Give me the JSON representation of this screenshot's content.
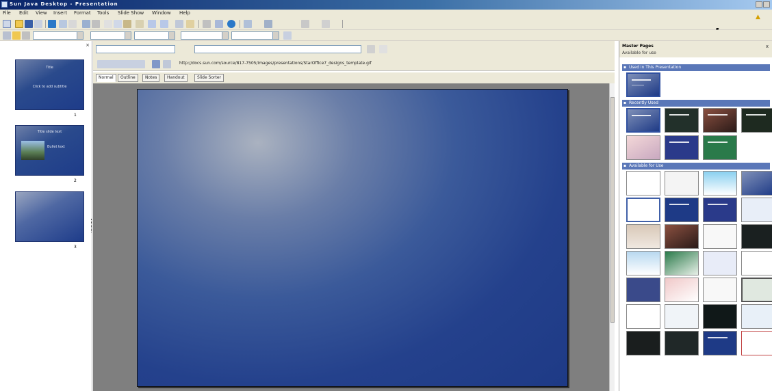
{
  "window": {
    "title": "Sun Java Desktop - Presentation"
  },
  "menu": [
    {
      "label": "File"
    },
    {
      "label": "Edit"
    },
    {
      "label": "View"
    },
    {
      "label": "Insert"
    },
    {
      "label": "Format"
    },
    {
      "label": "Tools"
    },
    {
      "label": "Slide Show"
    },
    {
      "label": "Window"
    },
    {
      "label": "Help"
    }
  ],
  "toolbar": {
    "font_size": "",
    "zoom_combo": ""
  },
  "path_bar": {
    "text": "http://docs.sun.com/source/817-7505/images/presentations/StarOffice7_designs_template.gif"
  },
  "view_tabs": [
    {
      "label": "Normal"
    },
    {
      "label": "Outline"
    },
    {
      "label": "Notes"
    },
    {
      "label": "Handout"
    },
    {
      "label": "Slide Sorter"
    }
  ],
  "slides": [
    {
      "number": "1",
      "title": "Title",
      "subtitle": "Click to add subtitle"
    },
    {
      "number": "2",
      "title": "Title slide text",
      "bullets": "Bullet text"
    },
    {
      "number": "3",
      "title": "",
      "subtitle": ""
    }
  ],
  "task_pane": {
    "title": "Master Pages",
    "subtitle": "Available for use",
    "close_label": "x",
    "sections": [
      {
        "label": "Used in This Presentation"
      },
      {
        "label": "Recently Used"
      },
      {
        "label": "Available for Use"
      }
    ]
  },
  "colors": {
    "slide_blue": "#1e3a86",
    "section_header": "#5a77b8",
    "chrome": "#ece9d8"
  }
}
